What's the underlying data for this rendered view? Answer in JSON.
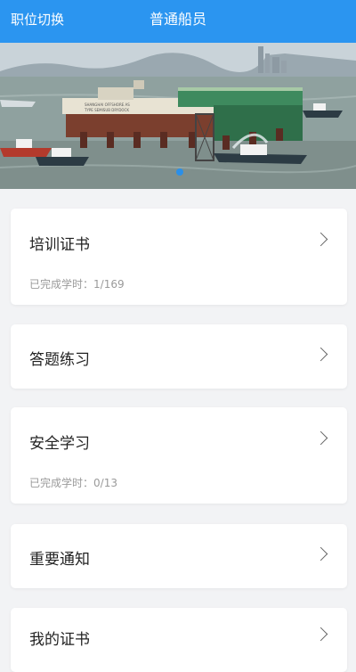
{
  "header": {
    "switch_label": "职位切换",
    "title": "普通船员"
  },
  "banner": {
    "ship_text_line1": "SHANGHAI OFFSHORE AS",
    "ship_text_line2": "TYPE SEMISUB DRYDOCK"
  },
  "cards": [
    {
      "title": "培训证书",
      "progress_label": "已完成学时：",
      "progress_value": "1/169"
    },
    {
      "title": "答题练习"
    },
    {
      "title": "安全学习",
      "progress_label": "已完成学时：",
      "progress_value": "0/13"
    },
    {
      "title": "重要通知"
    },
    {
      "title": "我的证书"
    }
  ],
  "colors": {
    "header_bg": "#2b95f0",
    "page_bg": "#f2f3f5",
    "card_bg": "#ffffff",
    "indicator_active": "#2b8fe8"
  },
  "icons": {
    "card_arrow": "chevron-right-icon",
    "carousel_indicator": "dot-indicator"
  }
}
